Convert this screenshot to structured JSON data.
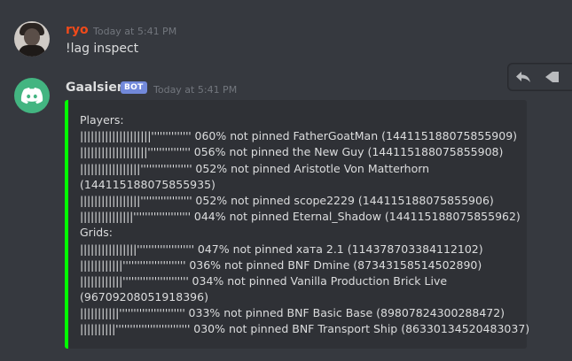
{
  "messages": [
    {
      "author": "ryo",
      "author_color": "#f04a1a",
      "timestamp": "Today at 5:41 PM",
      "content": "!lag inspect"
    },
    {
      "author": "Gaalsien",
      "author_color": "#dcddde",
      "badge": "BOT",
      "timestamp": "Today at 5:41 PM",
      "embed": {
        "border_color": "#00ff00",
        "lines": [
          {
            "text": "Players:"
          },
          {
            "bar": "||||||||||||||||||||''''''''''''''",
            "text": " 060% not pinned FatherGoatMan (144115188075855909)"
          },
          {
            "bar": "|||||||||||||||||||'''''''''''''''",
            "text": " 056% not pinned the New Guy (144115188075855908)"
          },
          {
            "bar": "|||||||||||||||||''''''''''''''''''",
            "text": " 052% not pinned Aristotle Von Matterhorn"
          },
          {
            "text": "(144115188075855935)"
          },
          {
            "bar": "|||||||||||||||||''''''''''''''''''",
            "text": " 052% not pinned scope2229 (144115188075855906)"
          },
          {
            "bar": "|||||||||||||||''''''''''''''''''''",
            "text": " 044% not pinned Eternal_Shadow (144115188075855962)"
          },
          {
            "text": "Grids:"
          },
          {
            "bar": "||||||||||||||||''''''''''''''''''''",
            "text": " 047% not pinned хата 2.1 (114378703384112102)"
          },
          {
            "bar": "||||||||||||''''''''''''''''''''''",
            "text": " 036% not pinned BNF Dmine (87343158514502890)"
          },
          {
            "bar": "||||||||||||'''''''''''''''''''''''",
            "text": " 034% not pinned Vanilla Production Brick Live"
          },
          {
            "text": "(96709208051918396)"
          },
          {
            "bar": "|||||||||||'''''''''''''''''''''''",
            "text": " 033% not pinned BNF Basic Base (89807824300288472)"
          },
          {
            "bar": "||||||||||''''''''''''''''''''''''''",
            "text": " 030% not pinned BNF Transport Ship (86330134520483037)"
          }
        ]
      }
    }
  ],
  "toolbar": {
    "reply_icon": "reply-icon",
    "more_icon": "more-icon"
  }
}
